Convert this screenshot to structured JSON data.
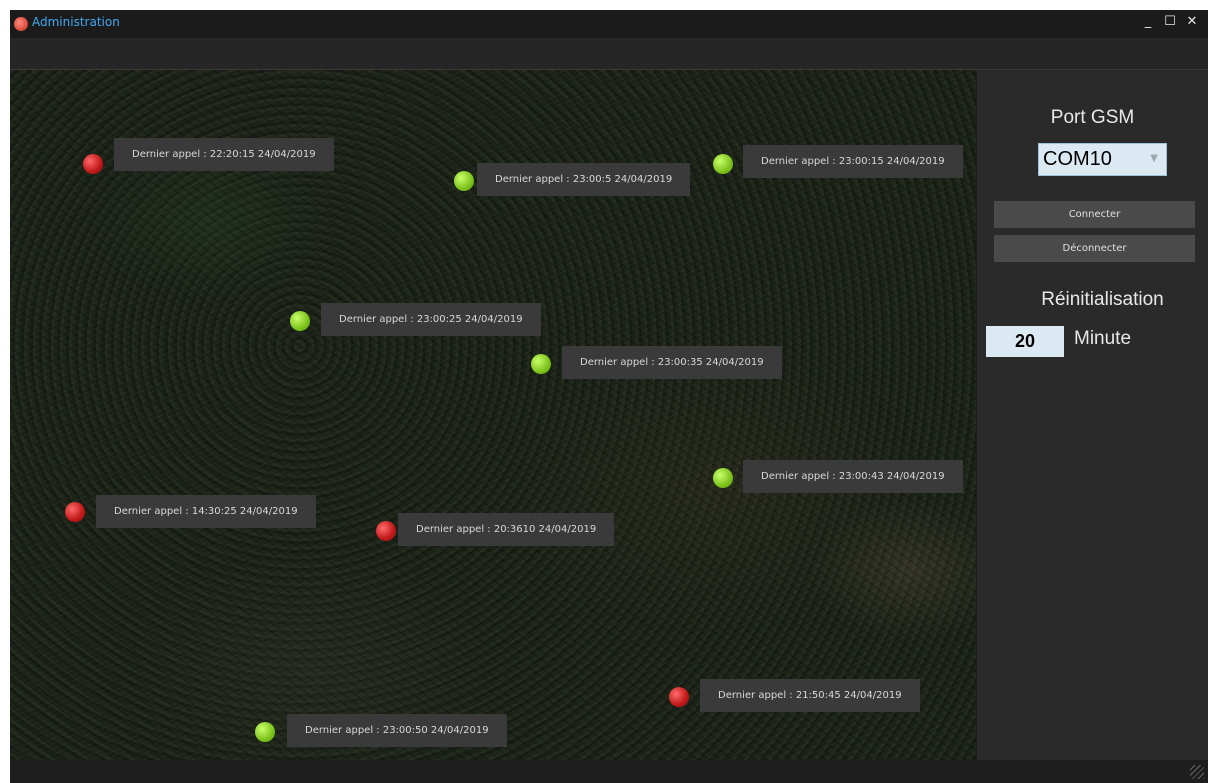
{
  "window": {
    "title": "Administration",
    "controls": {
      "minimize": "_",
      "maximize": "☐",
      "close": "✕"
    }
  },
  "map": {
    "markers": [
      {
        "status": "red",
        "label": "Dernier appel : 22:20:15 24/04/2019"
      },
      {
        "status": "green",
        "label": "Dernier appel : 23:00:5 24/04/2019"
      },
      {
        "status": "green",
        "label": "Dernier appel : 23:00:15 24/04/2019"
      },
      {
        "status": "green",
        "label": "Dernier appel : 23:00:25 24/04/2019"
      },
      {
        "status": "green",
        "label": "Dernier appel : 23:00:35 24/04/2019"
      },
      {
        "status": "green",
        "label": "Dernier appel : 23:00:43 24/04/2019"
      },
      {
        "status": "red",
        "label": "Dernier appel : 14:30:25 24/04/2019"
      },
      {
        "status": "red",
        "label": "Dernier appel : 20:3610 24/04/2019"
      },
      {
        "status": "red",
        "label": "Dernier appel : 21:50:45 24/04/2019"
      },
      {
        "status": "green",
        "label": "Dernier appel : 23:00:50 24/04/2019"
      }
    ]
  },
  "sidebar": {
    "port_title": "Port GSM",
    "port_value": "COM10",
    "connect_label": "Connecter",
    "disconnect_label": "Déconnecter",
    "reset_title": "Réinitialisation",
    "reset_value": "20",
    "reset_unit": "Minute"
  },
  "colors": {
    "title_text": "#41a8f0",
    "online": "#7cc21c",
    "offline": "#c01818",
    "input_bg": "#dbe9f2"
  }
}
